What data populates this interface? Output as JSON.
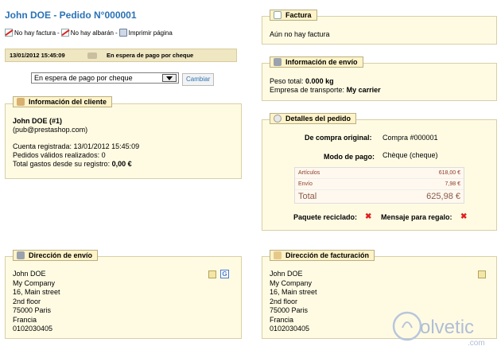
{
  "title": "John DOE - Pedido N°000001",
  "actions": {
    "no_invoice": "No hay factura",
    "sep": "-",
    "no_delivery": "No hay albarán",
    "print": "Imprimir página"
  },
  "status": {
    "date": "13/01/2012 15:45:09",
    "label": "En espera de pago por cheque",
    "select_value": "En espera de pago por cheque",
    "change_button": "Cambiar"
  },
  "customer": {
    "legend": "Información del cliente",
    "name": "John DOE (#1)",
    "email": "(pub@prestashop.com)",
    "registered": "Cuenta registrada: 13/01/2012 15:45:09",
    "valid_orders": "Pedidos válidos realizados: 0",
    "total_spent_label": "Total gastos desde su registro:",
    "total_spent_value": "0,00 €"
  },
  "invoice": {
    "legend": "Factura",
    "text": "Aún no hay factura"
  },
  "shipping": {
    "legend": "Información de envío",
    "weight_label": "Peso total:",
    "weight_value": "0.000 kg",
    "carrier_label": "Empresa de transporte:",
    "carrier_value": "My carrier"
  },
  "order": {
    "legend": "Detalles del pedido",
    "original_label": "De compra original:",
    "original_value": "Compra #000001",
    "payment_label": "Modo de pago:",
    "payment_value": "Chèque (cheque)",
    "rows": [
      {
        "label": "Artículos",
        "value": "618,00 €"
      },
      {
        "label": "Envío",
        "value": "7,98 €"
      }
    ],
    "total_label": "Total",
    "total_value": "625,98 €",
    "recycled_label": "Paquete reciclado:",
    "gift_label": "Mensaje para regalo:",
    "x": "✖"
  },
  "delivery_address": {
    "legend": "Dirección de envío",
    "lines": [
      "John DOE",
      "My Company",
      "16, Main street",
      "2nd floor",
      "75000 Paris",
      "Francia",
      "0102030405"
    ]
  },
  "billing_address": {
    "legend": "Dirección de facturación",
    "lines": [
      "John DOE",
      "My Company",
      "16, Main street",
      "2nd floor",
      "75000 Paris",
      "Francia",
      "0102030405"
    ]
  },
  "watermark": {
    "brand": "olvetic",
    "domain": ".com"
  },
  "colors": {
    "title": "#2a72b5",
    "panel_bg": "#fffbe3",
    "legend_bg": "#fff3c8",
    "status_bg": "#efe6c2",
    "x_red": "#e02020"
  }
}
